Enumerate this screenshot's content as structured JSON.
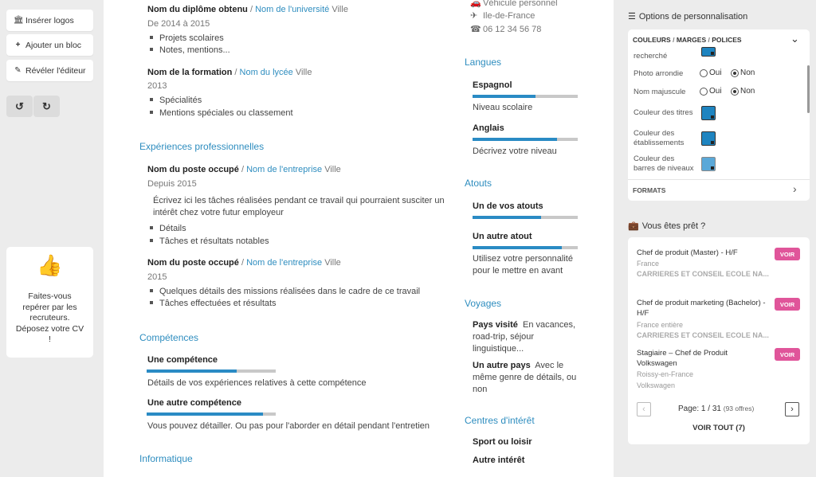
{
  "toolbar": {
    "logos": "Insérer logos",
    "add_block": "Ajouter un bloc",
    "reveal_editor": "Révéler l'éditeur"
  },
  "promo": {
    "text": "Faites-vous repérer par les recruteurs. Déposez votre CV !"
  },
  "cv": {
    "formation": [
      {
        "title": "Nom du diplôme obtenu",
        "sep": "/",
        "school": "Nom de l'université",
        "city": "Ville",
        "date": "De 2014 à 2015",
        "bullets": [
          "Projets scolaires",
          "Notes, mentions..."
        ]
      },
      {
        "title": "Nom de la formation",
        "sep": "/",
        "school": "Nom du lycée",
        "city": "Ville",
        "date": "2013",
        "bullets": [
          "Spécialités",
          "Mentions spéciales ou classement"
        ]
      }
    ],
    "experiences": {
      "heading": "Expériences professionnelles",
      "items": [
        {
          "title": "Nom du poste occupé",
          "sep": "/",
          "company": "Nom de l'entreprise",
          "city": "Ville",
          "date": "Depuis 2015",
          "desc": "Écrivez ici les tâches réalisées pendant ce travail qui pourraient susciter un intérêt chez votre futur employeur",
          "bullets": [
            "Détails",
            "Tâches et résultats notables"
          ]
        },
        {
          "title": "Nom du poste occupé",
          "sep": "/",
          "company": "Nom de l'entreprise",
          "city": "Ville",
          "date": "2015",
          "bullets": [
            "Quelques détails des missions réalisées dans le cadre de ce travail",
            "Tâches effectuées et résultats"
          ]
        }
      ]
    },
    "competences": {
      "heading": "Compétences",
      "items": [
        {
          "name": "Une compétence",
          "level": 0.7,
          "desc": "Détails de vos expériences relatives à cette compétence"
        },
        {
          "name": "Une autre compétence",
          "level": 0.9,
          "desc": "Vous pouvez détailler. Ou pas pour l'aborder en détail pendant l'entretien"
        }
      ]
    },
    "informatique": {
      "heading": "Informatique"
    },
    "contact": {
      "vehicle": "Véhicule personnel",
      "location": "Ile-de-France",
      "phone": "06 12 34 56 78"
    },
    "langues": {
      "heading": "Langues",
      "items": [
        {
          "name": "Espagnol",
          "level": 0.6,
          "desc": "Niveau scolaire"
        },
        {
          "name": "Anglais",
          "level": 0.8,
          "desc": "Décrivez votre niveau"
        }
      ]
    },
    "atouts": {
      "heading": "Atouts",
      "items": [
        {
          "name": "Un de vos atouts",
          "level": 0.65
        },
        {
          "name": "Un autre atout",
          "level": 0.85,
          "desc": "Utilisez votre personnalité pour le mettre en avant"
        }
      ]
    },
    "voyages": {
      "heading": "Voyages",
      "items": [
        {
          "name": "Pays visité",
          "desc": "En vacances, road-trip, séjour linguistique..."
        },
        {
          "name": "Un autre pays",
          "desc": "Avec le même genre de détails, ou non"
        }
      ]
    },
    "interets": {
      "heading": "Centres d'intérêt",
      "items": [
        "Sport ou loisir",
        "Autre intérêt"
      ]
    }
  },
  "options": {
    "heading": "Options de personnalisation",
    "tabs": {
      "couleurs": "COULEURS",
      "marges": "MARGES",
      "polices": "POLICES",
      "sep": "/"
    },
    "rows": {
      "recherche": "recherché",
      "photo": "Photo arrondie",
      "majuscule": "Nom majuscule",
      "titres": "Couleur des titres",
      "etablissements": "Couleur des établissements",
      "barres": "Couleur des barres de niveaux"
    },
    "oui": "Oui",
    "non": "Non",
    "formats": "FORMATS",
    "accent": "#1e84c0"
  },
  "jobs": {
    "heading": "Vous êtes prêt ?",
    "voir": "VOIR",
    "items": [
      {
        "title": "Chef de produit (Master) - H/F",
        "location": "France",
        "company": "CARRIERES ET CONSEIL ECOLE NA..."
      },
      {
        "title": "Chef de produit marketing (Bachelor) - H/F",
        "location": "France entière",
        "company": "CARRIERES ET CONSEIL ECOLE NA..."
      },
      {
        "title": "Stagiaire – Chef de Produit Volkswagen",
        "location": "Roissy-en-France",
        "company": "Volkswagen"
      }
    ],
    "page_label": "Page:",
    "page": "1 / 31",
    "offers": "(93 offres)",
    "voir_tout": "VOIR TOUT (7)",
    "voir_color": "#e0559a"
  }
}
